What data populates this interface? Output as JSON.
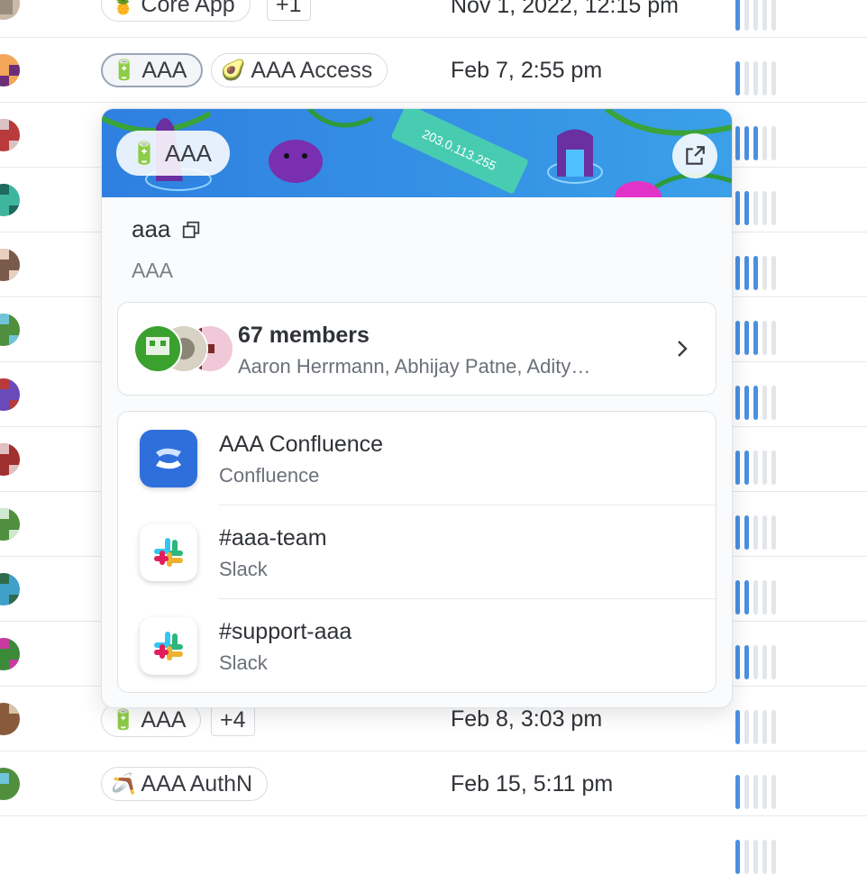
{
  "rows": [
    {
      "tags": [
        {
          "emoji": "🍍",
          "label": "Core App"
        }
      ],
      "more": "+1",
      "date": "Nov 1, 2022, 12:15 pm",
      "signal": 1
    },
    {
      "tags": [
        {
          "emoji": "🔋",
          "label": "AAA"
        },
        {
          "emoji": "🥑",
          "label": "AAA Access"
        }
      ],
      "more": "",
      "date": "Feb 7, 2:55 pm",
      "signal": 1
    },
    {
      "tags": [
        {
          "emoji": "🔋",
          "label": "AAA"
        }
      ],
      "more": "+4",
      "date": "Feb 8, 3:03 pm",
      "signal": 1
    },
    {
      "tags": [
        {
          "emoji": "🪃",
          "label": "AAA AuthN"
        }
      ],
      "more": "",
      "date": "Feb 15, 5:11 pm",
      "signal": 1
    }
  ],
  "row_signals": [
    1,
    1,
    3,
    2,
    3,
    3,
    3,
    2,
    2,
    2,
    2,
    1,
    1,
    1
  ],
  "popover": {
    "team_emoji": "🔋",
    "team_name": "AAA",
    "banner_text": "203.0.113.255",
    "handle": "aaa",
    "subtitle": "AAA",
    "members_title": "67 members",
    "members_names": "Aaron Herrmann, Abhijay Patne, Adity…",
    "links": [
      {
        "title": "AAA Confluence",
        "service": "Confluence",
        "icon": "confluence-icon"
      },
      {
        "title": "#aaa-team",
        "service": "Slack",
        "icon": "slack-icon"
      },
      {
        "title": "#support-aaa",
        "service": "Slack",
        "icon": "slack-icon"
      }
    ]
  },
  "colors": {
    "accent": "#4a90e2",
    "bar_off": "#e2e5e9",
    "confluence": "#2f6fdc"
  }
}
